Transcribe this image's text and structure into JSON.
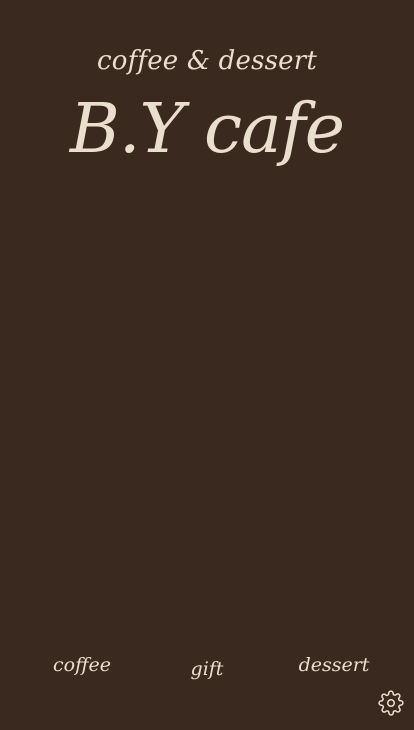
{
  "header": {
    "tagline": "coffee & dessert",
    "logo_text": "B.Y cafe"
  },
  "nav": {
    "items": [
      {
        "label": "coffee"
      },
      {
        "label": "gift"
      },
      {
        "label": "dessert"
      }
    ]
  },
  "settings": {
    "icon": "gear-icon"
  },
  "colors": {
    "background": "#3a291f",
    "text": "#eadfce"
  }
}
